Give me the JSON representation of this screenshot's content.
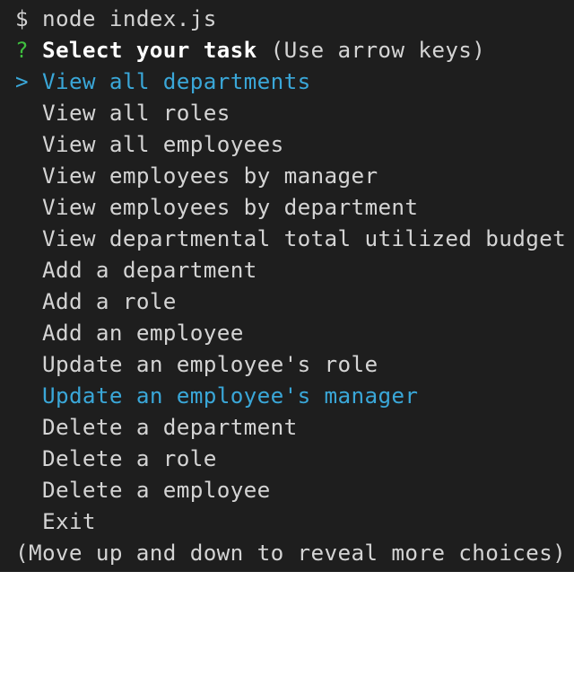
{
  "command_line": {
    "prompt_symbol": "$",
    "command": "node index.js"
  },
  "question": {
    "marker": "?",
    "text": "Select your task",
    "hint": "(Use arrow keys)"
  },
  "menu": {
    "pointer": ">",
    "highlight_color": "#3aa7d8",
    "items": [
      {
        "label": "View all departments",
        "selected": true,
        "highlighted": true
      },
      {
        "label": "View all roles",
        "selected": false,
        "highlighted": false
      },
      {
        "label": "View all employees",
        "selected": false,
        "highlighted": false
      },
      {
        "label": "View employees by manager",
        "selected": false,
        "highlighted": false
      },
      {
        "label": "View employees by department",
        "selected": false,
        "highlighted": false
      },
      {
        "label": "View departmental total utilized budget",
        "selected": false,
        "highlighted": false
      },
      {
        "label": "Add a department",
        "selected": false,
        "highlighted": false
      },
      {
        "label": "Add a role",
        "selected": false,
        "highlighted": false
      },
      {
        "label": "Add an employee",
        "selected": false,
        "highlighted": false
      },
      {
        "label": "Update an employee's role",
        "selected": false,
        "highlighted": false
      },
      {
        "label": "Update an employee's manager",
        "selected": false,
        "highlighted": true
      },
      {
        "label": "Delete a department",
        "selected": false,
        "highlighted": false
      },
      {
        "label": "Delete a role",
        "selected": false,
        "highlighted": false
      },
      {
        "label": "Delete a employee",
        "selected": false,
        "highlighted": false
      },
      {
        "label": "Exit",
        "selected": false,
        "highlighted": false
      }
    ]
  },
  "footer_hint": "(Move up and down to reveal more choices)",
  "colors": {
    "background": "#1e1e1e",
    "text": "#d4d4d4",
    "prompt_marker": "#3fbf3f",
    "highlight": "#3aa7d8"
  }
}
